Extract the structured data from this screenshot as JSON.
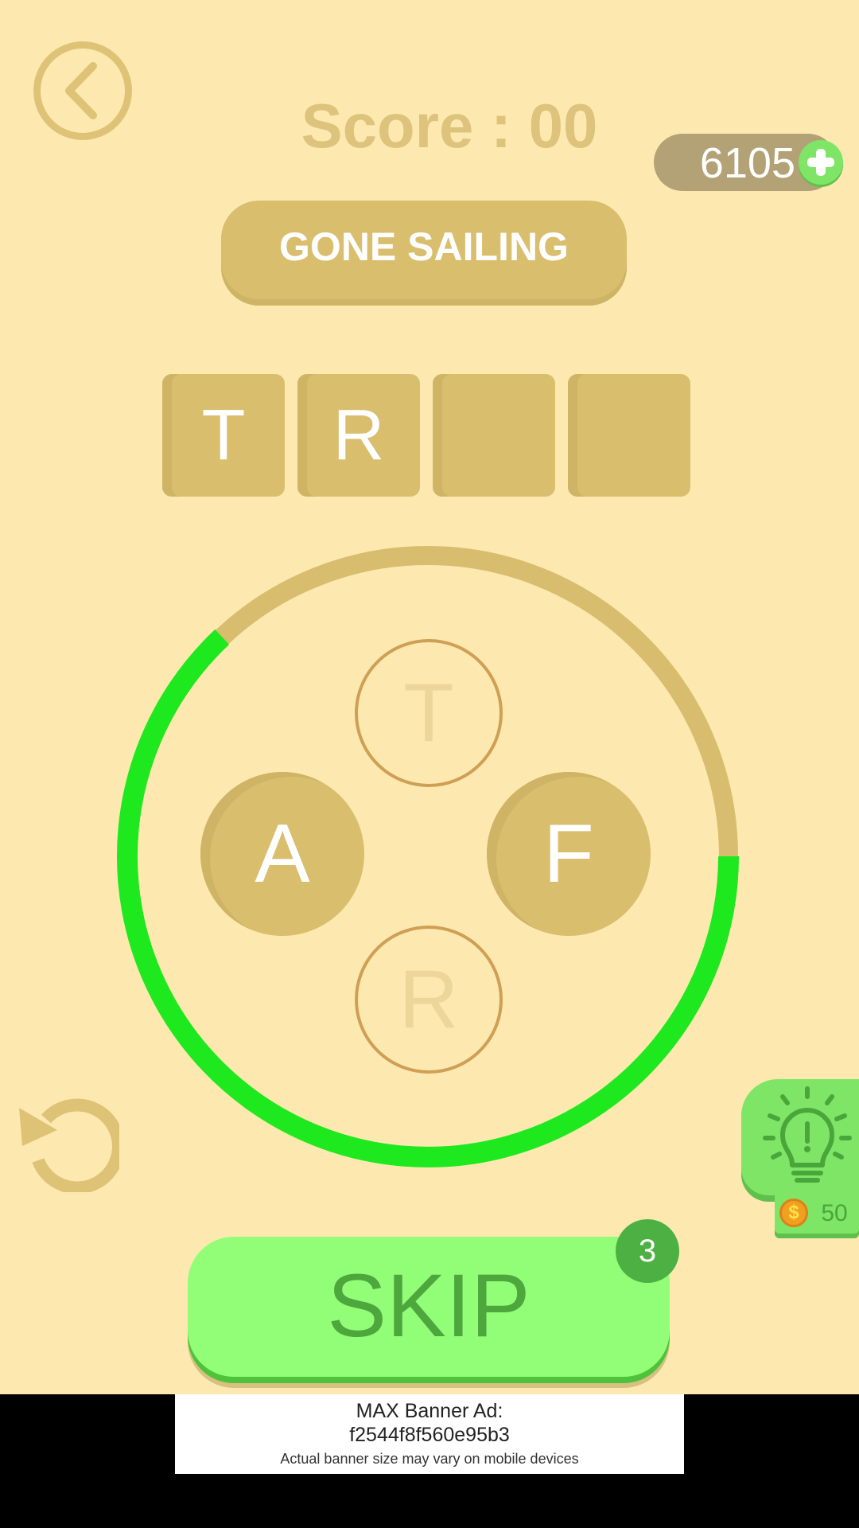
{
  "header": {
    "score_label": "Score : 00",
    "coins": "6105",
    "back_icon": "chevron-left-icon",
    "add_coins_icon": "plus-icon"
  },
  "category": "GONE SAILING",
  "answer_slots": [
    "T",
    "R",
    "",
    ""
  ],
  "letter_wheel": {
    "top": "T",
    "left": "A",
    "right": "F",
    "bottom": "R",
    "timer_progress": 0.63
  },
  "hint": {
    "icon": "lightbulb-icon",
    "coin_icon": "dollar-coin-icon",
    "coin_symbol": "$",
    "cost": "50"
  },
  "refresh_icon": "refresh-icon",
  "skip": {
    "label": "SKIP",
    "count": "3"
  },
  "ad": {
    "line1": "MAX Banner Ad:",
    "line2": "f2544f8f560e95b3",
    "line3": "Actual banner size may vary on mobile devices"
  },
  "colors": {
    "background": "#fde9b0",
    "tan": "#d9be6e",
    "green": "#92fe78",
    "timer_green": "#1ee81e"
  }
}
